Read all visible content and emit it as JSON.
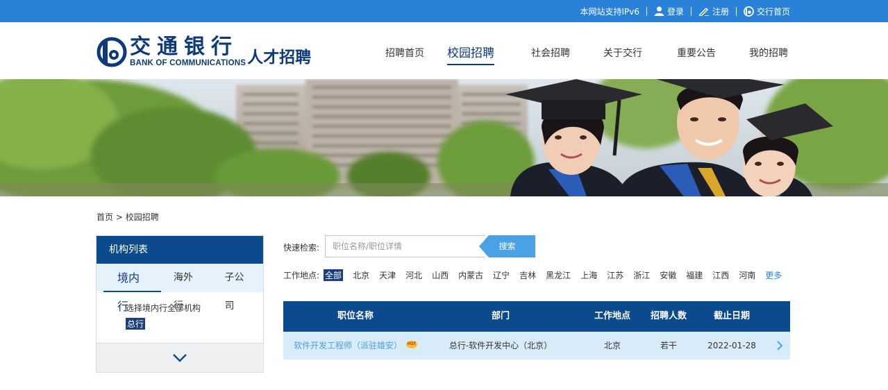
{
  "topbar": {
    "ipv6": "本网站支持IPv6",
    "login": "登录",
    "register": "注册",
    "home": "交行首页",
    "icons": [
      "user-icon",
      "pen-icon",
      "bocom-logo-icon"
    ]
  },
  "header": {
    "logo_cn": "交通银行",
    "logo_en": "BANK OF COMMUNICATIONS",
    "logo_suffix": "人才招聘",
    "nav": [
      "招聘首页",
      "校园招聘",
      "社会招聘",
      "关于交行",
      "重要公告",
      "我的招聘"
    ],
    "active_nav": "校园招聘"
  },
  "breadcrumb": {
    "home": "首页",
    "separator": " > ",
    "current": "校园招聘"
  },
  "sidebar": {
    "title": "机构列表",
    "tabs": [
      "境内行",
      "海外行",
      "子公司"
    ],
    "active_tab": "境内行",
    "select_all": "选择境内行全部机构",
    "selected": "总行"
  },
  "search": {
    "label": "快速检索:",
    "placeholder": "职位名称/职位详情",
    "value": "",
    "button": "搜索"
  },
  "location": {
    "label": "工作地点:",
    "items": [
      "全部",
      "北京",
      "天津",
      "河北",
      "山西",
      "内蒙古",
      "辽宁",
      "吉林",
      "黑龙江",
      "上海",
      "江苏",
      "浙江",
      "安徽",
      "福建",
      "江西",
      "河南"
    ],
    "active": "全部",
    "more": "更多"
  },
  "table": {
    "headers": [
      "职位名称",
      "部门",
      "工作地点",
      "招聘人数",
      "截止日期"
    ],
    "rows": [
      {
        "title": "软件开发工程师（派驻雄安）",
        "hot": "HOT",
        "dept": "总行-软件开发中心（北京）",
        "location": "北京",
        "count": "若干",
        "deadline": "2022-01-28"
      }
    ]
  },
  "colors": {
    "topbar": "#2a82d8",
    "brand": "#0c3a7b",
    "table_header": "#0c4a8e",
    "row_bg": "#d8ebf9",
    "link": "#4ba1e6"
  }
}
